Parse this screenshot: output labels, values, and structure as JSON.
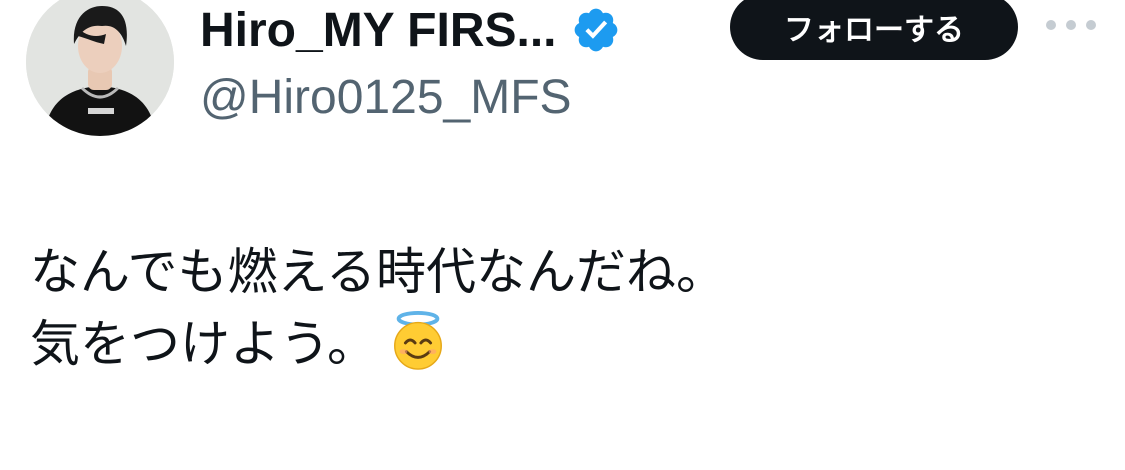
{
  "author": {
    "display_name": "Hiro_MY FIRS...",
    "handle": "@Hiro0125_MFS",
    "verified": true,
    "verified_color": "#1d9bf0",
    "avatar": "profile-photo"
  },
  "actions": {
    "follow_label": "フォローする",
    "more_icon": "more-horizontal-icon"
  },
  "tweet": {
    "lines": [
      "なんでも燃える時代なんだね。",
      "気をつけよう。"
    ],
    "emoji": "smiling-face-with-halo"
  },
  "colors": {
    "text_primary": "#0f1419",
    "text_secondary": "#536471",
    "button_bg": "#0f1419",
    "button_text": "#ffffff",
    "background": "#ffffff"
  }
}
